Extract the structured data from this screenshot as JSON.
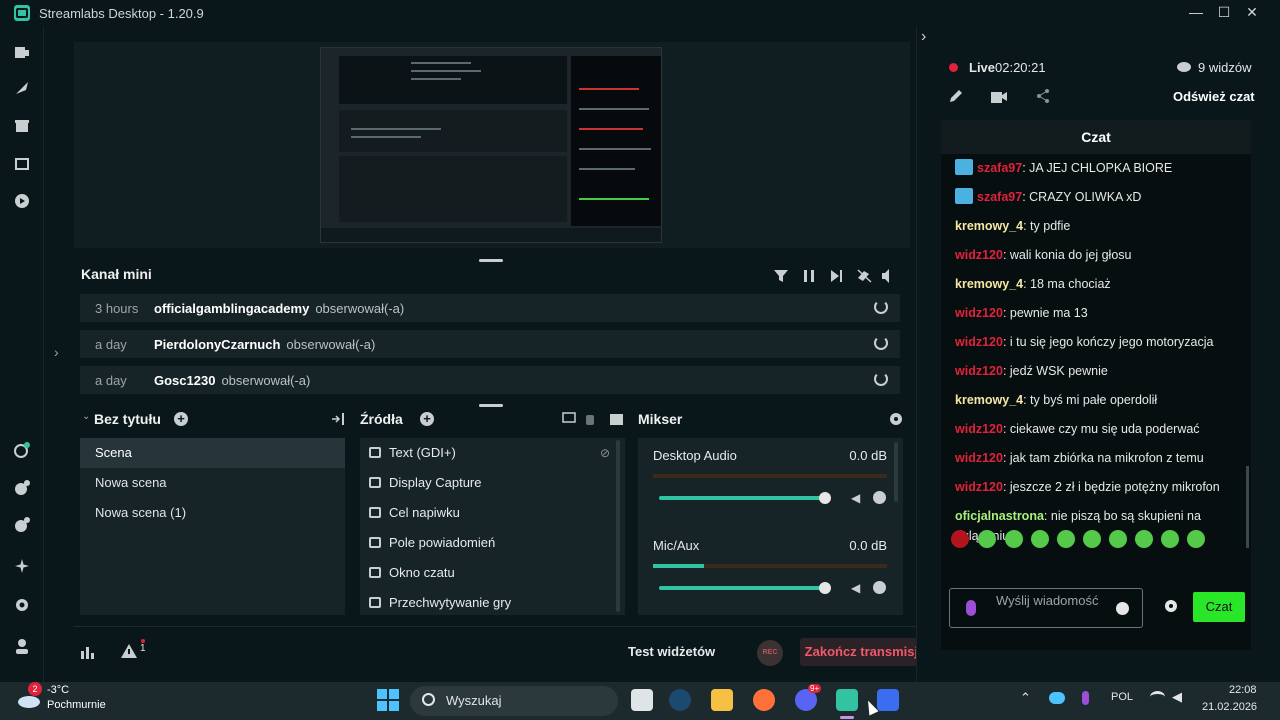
{
  "app": {
    "title": "Streamlabs Desktop - 1.20.9"
  },
  "window_controls": {
    "minimize": "—",
    "maximize": "☐",
    "close": "✕"
  },
  "sidebar_left": {
    "icons": [
      "studio-icon",
      "themes-icon",
      "store-icon",
      "overlays-icon",
      "record-play-icon",
      "collab-icon",
      "apps-icon",
      "add-ons-icon",
      "effects-icon",
      "settings-icon",
      "profile-icon"
    ]
  },
  "events": {
    "title": "Kanał mini",
    "rows": [
      {
        "time": "3 hours",
        "user": "officialgamblingacademy",
        "action": "obserwował(-a)"
      },
      {
        "time": "a day",
        "user": "PierdolonyCzarnuch",
        "action": "obserwował(-a)"
      },
      {
        "time": "a day",
        "user": "Gosc1230",
        "action": "obserwował(-a)"
      }
    ]
  },
  "scenes": {
    "title": "Bez tytułu",
    "items": [
      "Scena",
      "Nowa scena",
      "Nowa scena (1)"
    ],
    "active_index": 0
  },
  "sources": {
    "title": "Źródła",
    "items": [
      "Text (GDI+)",
      "Display Capture",
      "Cel napiwku",
      "Pole powiadomień",
      "Okno czatu",
      "Przechwytywanie gry"
    ]
  },
  "mixer": {
    "title": "Mikser",
    "channels": [
      {
        "name": "Desktop Audio",
        "db": "0.0 dB",
        "level": 0.0,
        "volume": 1.0
      },
      {
        "name": "Mic/Aux",
        "db": "0.0 dB",
        "level": 0.22,
        "volume": 1.0
      }
    ]
  },
  "footer": {
    "alert_count": "1",
    "test_widgets": "Test widżetów",
    "rec": "REC",
    "end_stream": "Zakończ transmisję"
  },
  "live": {
    "status": "Live",
    "time": "02:20:21",
    "viewers": "9 widzów",
    "refresh_chat": "Odśwież czat"
  },
  "chat": {
    "title": "Czat",
    "messages": [
      {
        "user": "szafa97",
        "text": ": JA JEJ CHLOPKA BIORE",
        "color": "#e0223a",
        "badge": true
      },
      {
        "user": "szafa97",
        "text": ": CRAZY OLIWKA xD",
        "color": "#e0223a",
        "badge": true
      },
      {
        "user": "kremowy_4",
        "text": ": ty pdfie",
        "color": "#f5e6a3",
        "badge": false
      },
      {
        "user": "widz120",
        "text": ": wali konia do jej głosu",
        "color": "#e0223a",
        "badge": false
      },
      {
        "user": "kremowy_4",
        "text": ": 18 ma chociaż",
        "color": "#f5e6a3",
        "badge": false
      },
      {
        "user": "widz120",
        "text": ": pewnie ma 13",
        "color": "#e0223a",
        "badge": false
      },
      {
        "user": "widz120",
        "text": ": i tu się jego kończy jego motoryzacja",
        "color": "#e0223a",
        "badge": false
      },
      {
        "user": "widz120",
        "text": ": jedź WSK pewnie",
        "color": "#e0223a",
        "badge": false
      },
      {
        "user": "kremowy_4",
        "text": ": ty byś mi pałe operdolił",
        "color": "#f5e6a3",
        "badge": false
      },
      {
        "user": "widz120",
        "text": ": ciekawe czy mu się uda poderwać",
        "color": "#e0223a",
        "badge": false
      },
      {
        "user": "widz120",
        "text": ": jak tam zbiórka na mikrofon z temu",
        "color": "#e0223a",
        "badge": false
      },
      {
        "user": "widz120",
        "text": ": jeszcze 2 zł i będzie potężny mikrofon",
        "color": "#e0223a",
        "badge": false
      },
      {
        "user": "oficjalnastrona",
        "text": ": nie piszą bo są skupieni na oglądaniu",
        "color": "#a8f07a",
        "badge": false
      }
    ],
    "input_placeholder": "Wyślij wiadomość",
    "send_label": "Czat"
  },
  "taskbar": {
    "weather_temp": "-3°C",
    "weather_desc": "Pochmurnie",
    "weather_badge": "2",
    "search_label": "Wyszukaj",
    "discord_badge": "9+",
    "lang": "POL",
    "time": "22:08",
    "date": "21.02.2026"
  },
  "colors": {
    "accent": "#31c3a2",
    "live_red": "#e0223a",
    "send_green": "#29e629",
    "end_stream_text": "#f2586a"
  }
}
